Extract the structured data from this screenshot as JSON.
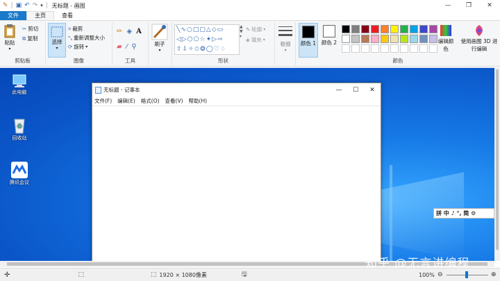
{
  "window": {
    "title": "无标题 - 画图"
  },
  "tabs": [
    {
      "label": "文件"
    },
    {
      "label": "主页"
    },
    {
      "label": "查看"
    }
  ],
  "clipboard": {
    "paste": "粘贴",
    "cut": "剪切",
    "copy": "复制",
    "group": "剪贴板"
  },
  "image": {
    "select": "选择",
    "crop": "裁剪",
    "resize": "重新调整大小",
    "rotate": "旋转",
    "group": "图像"
  },
  "tools": {
    "group": "工具",
    "text_glyph": "A"
  },
  "brush": {
    "label": "刷子"
  },
  "shapes": {
    "outline": "轮廓",
    "fill": "填充",
    "group": "形状"
  },
  "size": {
    "label": "粗细"
  },
  "colors": {
    "color1": "颜色 1",
    "color2": "颜色 2",
    "group": "颜色",
    "edit": "编辑颜色",
    "paint3d": "使用画图 3D 进行编辑",
    "palette": [
      "#000000",
      "#7f7f7f",
      "#880015",
      "#ed1c24",
      "#ff7f27",
      "#fff200",
      "#22b14c",
      "#00a2e8",
      "#3f48cc",
      "#a349a4",
      "#ffffff",
      "#c3c3c3",
      "#b97a57",
      "#ffaec9",
      "#ffc90e",
      "#efe4b0",
      "#b5e61d",
      "#99d9ea",
      "#7092be",
      "#c8bfe7"
    ]
  },
  "desktop": {
    "icons": [
      {
        "label": "此电脑"
      },
      {
        "label": "回收站"
      },
      {
        "label": "腾讯会议"
      }
    ]
  },
  "notepad": {
    "title": "无标题 - 记事本",
    "menu": [
      "文件(F)",
      "编辑(E)",
      "格式(O)",
      "查看(V)",
      "帮助(H)"
    ]
  },
  "ime": {
    "label": "拼 中 ♪ °, 简 ⚙"
  },
  "status": {
    "dimensions": "1920 × 1080像素",
    "zoom": "100%"
  },
  "watermark": {
    "text": "知乎 @无言讲编程"
  }
}
